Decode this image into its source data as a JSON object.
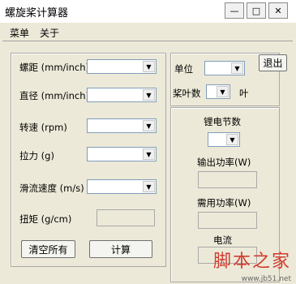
{
  "window": {
    "title": "螺旋桨计算器",
    "minimize": "—",
    "maximize": "□",
    "close": "✕"
  },
  "menu": [
    "菜单",
    "关于"
  ],
  "left_panel": {
    "pitch_label": "螺距 (mm/inch)",
    "diameter_label": "直径 (mm/inch)",
    "speed_label": "转速 (rpm)",
    "thrust_label": "拉力 (g)",
    "slip_label": "滑流速度 (m/s)",
    "torque_label": "扭矩 (g/cm)",
    "clear_button": "清空所有",
    "calc_button": "计算"
  },
  "right_panel": {
    "unit_label": "单位",
    "blades_label": "桨叶数",
    "blades_suffix": "叶",
    "exit_button": "退出"
  },
  "motor_panel": {
    "cells_label": "锂电节数",
    "output_power_label": "输出功率(W)",
    "required_power_label": "需用功率(W)",
    "current_label": "电流"
  },
  "watermark": {
    "text": "脚本之家",
    "url": "www.jb51.net"
  }
}
